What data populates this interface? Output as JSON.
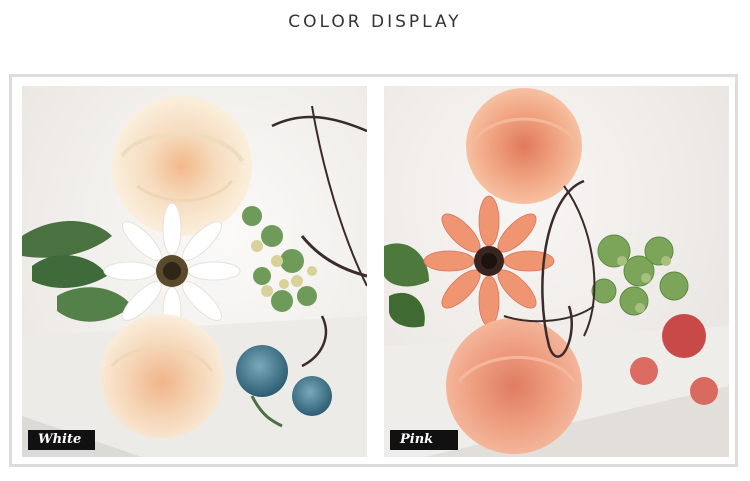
{
  "title": "COLOR DISPLAY",
  "panels": [
    {
      "label": "White",
      "colors": {
        "background": "#f4f2ef",
        "rose": "#f7ead2",
        "rose_center": "#f2c8a0",
        "daisy": "#ffffff",
        "daisy_center": "#3a3020",
        "leaf": "#3f6a3a",
        "bud": "#3b6f86",
        "berries": "#c9c48a"
      }
    },
    {
      "label": "Pink",
      "colors": {
        "background": "#f2efec",
        "rose": "#f0a784",
        "rose_center": "#e0846a",
        "dahlia": "#ee8f6d",
        "dahlia_center": "#2b1a18",
        "leaf": "#4d7a3c",
        "succulent": "#7da55a",
        "accent": "#c94848"
      }
    }
  ]
}
